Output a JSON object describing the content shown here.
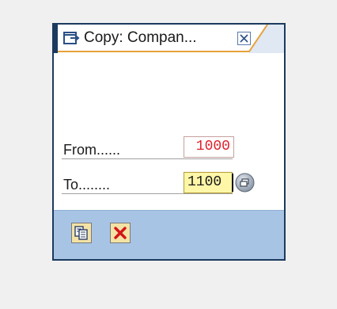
{
  "dialog": {
    "title": "Copy: Compan...",
    "close_icon": "close-icon",
    "title_icon": "dialog-window-icon"
  },
  "form": {
    "from_label": "From......",
    "from_value": "1000",
    "to_label": "To........",
    "to_value": "1100",
    "value_help_icon": "value-help-icon"
  },
  "toolbar": {
    "copy_icon": "copy-icon",
    "cancel_icon": "cancel-icon"
  },
  "colors": {
    "frame": "#1c3a5e",
    "title_accent": "#e8a13a",
    "toolbar_bg": "#a8c4e4",
    "from_value_color": "#e0202a",
    "to_field_bg": "#fff7a8",
    "button_bg": "#f3e2a4",
    "cancel_red": "#d4141a"
  }
}
